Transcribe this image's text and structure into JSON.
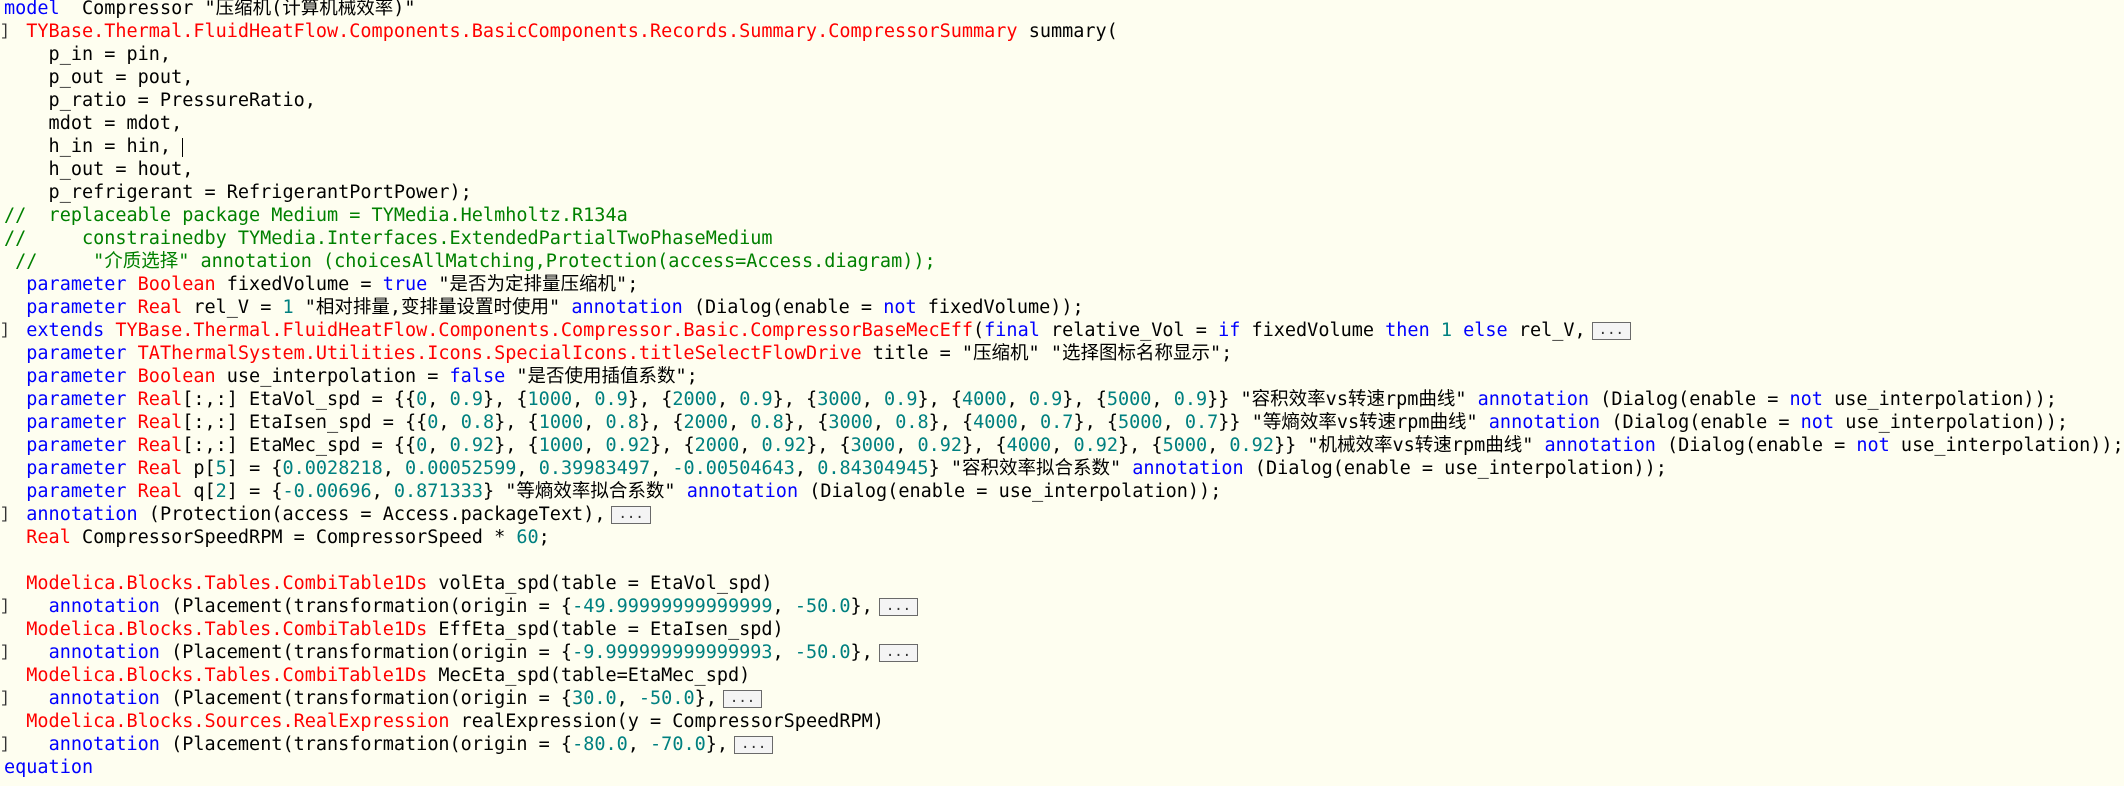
{
  "fold_label": "...",
  "lines": [
    {
      "fold": false,
      "tokens": [
        [
          "kw",
          "model"
        ],
        [
          "",
          "  Compressor "
        ],
        [
          "str",
          "\"压缩机(计算机械效率)\""
        ]
      ]
    },
    {
      "fold": true,
      "tokens": [
        [
          "",
          "  "
        ],
        [
          "ty",
          "TYBase.Thermal.FluidHeatFlow.Components.BasicComponents.Records.Summary.CompressorSummary"
        ],
        [
          "",
          " summary("
        ]
      ]
    },
    {
      "fold": false,
      "tokens": [
        [
          "",
          "    p_in = pin,"
        ]
      ]
    },
    {
      "fold": false,
      "tokens": [
        [
          "",
          "    p_out = pout,"
        ]
      ]
    },
    {
      "fold": false,
      "tokens": [
        [
          "",
          "    p_ratio = PressureRatio,"
        ]
      ]
    },
    {
      "fold": false,
      "tokens": [
        [
          "",
          "    mdot = mdot,"
        ]
      ]
    },
    {
      "fold": false,
      "cursor": true,
      "tokens": [
        [
          "",
          "    h_in = hin, "
        ]
      ]
    },
    {
      "fold": false,
      "tokens": [
        [
          "",
          "    h_out = hout,"
        ]
      ]
    },
    {
      "fold": false,
      "tokens": [
        [
          "",
          "    p_refrigerant = RefrigerantPortPower);"
        ]
      ]
    },
    {
      "fold": false,
      "tokens": [
        [
          "cm",
          "//  replaceable package Medium = TYMedia.Helmholtz.R134a"
        ]
      ]
    },
    {
      "fold": false,
      "tokens": [
        [
          "cm",
          "//     constrainedby TYMedia.Interfaces.ExtendedPartialTwoPhaseMedium"
        ]
      ]
    },
    {
      "fold": false,
      "tokens": [
        [
          "cm",
          " //     \"介质选择\" annotation (choicesAllMatching,Protection(access=Access.diagram));"
        ]
      ]
    },
    {
      "fold": false,
      "tokens": [
        [
          "",
          "  "
        ],
        [
          "kw",
          "parameter"
        ],
        [
          "",
          " "
        ],
        [
          "ty",
          "Boolean"
        ],
        [
          "",
          " fixedVolume = "
        ],
        [
          "kw",
          "true"
        ],
        [
          "",
          " "
        ],
        [
          "str",
          "\"是否为定排量压缩机\""
        ],
        [
          "",
          ";"
        ]
      ]
    },
    {
      "fold": false,
      "tokens": [
        [
          "",
          "  "
        ],
        [
          "kw",
          "parameter"
        ],
        [
          "",
          " "
        ],
        [
          "ty",
          "Real"
        ],
        [
          "",
          " rel_V = "
        ],
        [
          "num",
          "1"
        ],
        [
          "",
          " "
        ],
        [
          "str",
          "\"相对排量,变排量设置时使用\""
        ],
        [
          "",
          " "
        ],
        [
          "kw",
          "annotation"
        ],
        [
          "",
          " (Dialog(enable = "
        ],
        [
          "kw",
          "not"
        ],
        [
          "",
          " fixedVolume));"
        ]
      ]
    },
    {
      "fold": true,
      "more": true,
      "tokens": [
        [
          "",
          "  "
        ],
        [
          "kw",
          "extends"
        ],
        [
          "",
          " "
        ],
        [
          "ty",
          "TYBase.Thermal.FluidHeatFlow.Components.Compressor.Basic.CompressorBaseMecEff"
        ],
        [
          "",
          "("
        ],
        [
          "kw",
          "final"
        ],
        [
          "",
          " relative_Vol = "
        ],
        [
          "kw",
          "if"
        ],
        [
          "",
          " fixedVolume "
        ],
        [
          "kw",
          "then"
        ],
        [
          "",
          " "
        ],
        [
          "num",
          "1"
        ],
        [
          "",
          " "
        ],
        [
          "kw",
          "else"
        ],
        [
          "",
          " rel_V,"
        ]
      ]
    },
    {
      "fold": false,
      "tokens": [
        [
          "",
          "  "
        ],
        [
          "kw",
          "parameter"
        ],
        [
          "",
          " "
        ],
        [
          "ty",
          "TAThermalSystem.Utilities.Icons.SpecialIcons.titleSelectFlowDrive"
        ],
        [
          "",
          " title = "
        ],
        [
          "str",
          "\"压缩机\""
        ],
        [
          "",
          " "
        ],
        [
          "str",
          "\"选择图标名称显示\""
        ],
        [
          "",
          ";"
        ]
      ]
    },
    {
      "fold": false,
      "tokens": [
        [
          "",
          "  "
        ],
        [
          "kw",
          "parameter"
        ],
        [
          "",
          " "
        ],
        [
          "ty",
          "Boolean"
        ],
        [
          "",
          " use_interpolation = "
        ],
        [
          "kw",
          "false"
        ],
        [
          "",
          " "
        ],
        [
          "str",
          "\"是否使用插值系数\""
        ],
        [
          "",
          ";"
        ]
      ]
    },
    {
      "fold": false,
      "tokens": [
        [
          "",
          "  "
        ],
        [
          "kw",
          "parameter"
        ],
        [
          "",
          " "
        ],
        [
          "ty",
          "Real"
        ],
        [
          "",
          "[:,:] EtaVol_spd = {{"
        ],
        [
          "num",
          "0"
        ],
        [
          "",
          ", "
        ],
        [
          "num",
          "0.9"
        ],
        [
          "",
          "}, {"
        ],
        [
          "num",
          "1000"
        ],
        [
          "",
          ", "
        ],
        [
          "num",
          "0.9"
        ],
        [
          "",
          "}, {"
        ],
        [
          "num",
          "2000"
        ],
        [
          "",
          ", "
        ],
        [
          "num",
          "0.9"
        ],
        [
          "",
          "}, {"
        ],
        [
          "num",
          "3000"
        ],
        [
          "",
          ", "
        ],
        [
          "num",
          "0.9"
        ],
        [
          "",
          "}, {"
        ],
        [
          "num",
          "4000"
        ],
        [
          "",
          ", "
        ],
        [
          "num",
          "0.9"
        ],
        [
          "",
          "}, {"
        ],
        [
          "num",
          "5000"
        ],
        [
          "",
          ", "
        ],
        [
          "num",
          "0.9"
        ],
        [
          "",
          "}} "
        ],
        [
          "str",
          "\"容积效率vs转速rpm曲线\""
        ],
        [
          "",
          " "
        ],
        [
          "kw",
          "annotation"
        ],
        [
          "",
          " (Dialog(enable = "
        ],
        [
          "kw",
          "not"
        ],
        [
          "",
          " use_interpolation));"
        ]
      ]
    },
    {
      "fold": false,
      "tokens": [
        [
          "",
          "  "
        ],
        [
          "kw",
          "parameter"
        ],
        [
          "",
          " "
        ],
        [
          "ty",
          "Real"
        ],
        [
          "",
          "[:,:] EtaIsen_spd = {{"
        ],
        [
          "num",
          "0"
        ],
        [
          "",
          ", "
        ],
        [
          "num",
          "0.8"
        ],
        [
          "",
          "}, {"
        ],
        [
          "num",
          "1000"
        ],
        [
          "",
          ", "
        ],
        [
          "num",
          "0.8"
        ],
        [
          "",
          "}, {"
        ],
        [
          "num",
          "2000"
        ],
        [
          "",
          ", "
        ],
        [
          "num",
          "0.8"
        ],
        [
          "",
          "}, {"
        ],
        [
          "num",
          "3000"
        ],
        [
          "",
          ", "
        ],
        [
          "num",
          "0.8"
        ],
        [
          "",
          "}, {"
        ],
        [
          "num",
          "4000"
        ],
        [
          "",
          ", "
        ],
        [
          "num",
          "0.7"
        ],
        [
          "",
          "}, {"
        ],
        [
          "num",
          "5000"
        ],
        [
          "",
          ", "
        ],
        [
          "num",
          "0.7"
        ],
        [
          "",
          "}} "
        ],
        [
          "str",
          "\"等熵效率vs转速rpm曲线\""
        ],
        [
          "",
          " "
        ],
        [
          "kw",
          "annotation"
        ],
        [
          "",
          " (Dialog(enable = "
        ],
        [
          "kw",
          "not"
        ],
        [
          "",
          " use_interpolation));"
        ]
      ]
    },
    {
      "fold": false,
      "tokens": [
        [
          "",
          "  "
        ],
        [
          "kw",
          "parameter"
        ],
        [
          "",
          " "
        ],
        [
          "ty",
          "Real"
        ],
        [
          "",
          "[:,:] EtaMec_spd = {{"
        ],
        [
          "num",
          "0"
        ],
        [
          "",
          ", "
        ],
        [
          "num",
          "0.92"
        ],
        [
          "",
          "}, {"
        ],
        [
          "num",
          "1000"
        ],
        [
          "",
          ", "
        ],
        [
          "num",
          "0.92"
        ],
        [
          "",
          "}, {"
        ],
        [
          "num",
          "2000"
        ],
        [
          "",
          ", "
        ],
        [
          "num",
          "0.92"
        ],
        [
          "",
          "}, {"
        ],
        [
          "num",
          "3000"
        ],
        [
          "",
          ", "
        ],
        [
          "num",
          "0.92"
        ],
        [
          "",
          "}, {"
        ],
        [
          "num",
          "4000"
        ],
        [
          "",
          ", "
        ],
        [
          "num",
          "0.92"
        ],
        [
          "",
          "}, {"
        ],
        [
          "num",
          "5000"
        ],
        [
          "",
          ", "
        ],
        [
          "num",
          "0.92"
        ],
        [
          "",
          "}} "
        ],
        [
          "str",
          "\"机械效率vs转速rpm曲线\""
        ],
        [
          "",
          " "
        ],
        [
          "kw",
          "annotation"
        ],
        [
          "",
          " (Dialog(enable = "
        ],
        [
          "kw",
          "not"
        ],
        [
          "",
          " use_interpolation));"
        ]
      ]
    },
    {
      "fold": false,
      "tokens": [
        [
          "",
          "  "
        ],
        [
          "kw",
          "parameter"
        ],
        [
          "",
          " "
        ],
        [
          "ty",
          "Real"
        ],
        [
          "",
          " p["
        ],
        [
          "num",
          "5"
        ],
        [
          "",
          "] = {"
        ],
        [
          "num",
          "0.0028218"
        ],
        [
          "",
          ", "
        ],
        [
          "num",
          "0.00052599"
        ],
        [
          "",
          ", "
        ],
        [
          "num",
          "0.39983497"
        ],
        [
          "",
          ", "
        ],
        [
          "num",
          "-0.00504643"
        ],
        [
          "",
          ", "
        ],
        [
          "num",
          "0.84304945"
        ],
        [
          "",
          "} "
        ],
        [
          "str",
          "\"容积效率拟合系数\""
        ],
        [
          "",
          " "
        ],
        [
          "kw",
          "annotation"
        ],
        [
          "",
          " (Dialog(enable = use_interpolation));"
        ]
      ]
    },
    {
      "fold": false,
      "tokens": [
        [
          "",
          "  "
        ],
        [
          "kw",
          "parameter"
        ],
        [
          "",
          " "
        ],
        [
          "ty",
          "Real"
        ],
        [
          "",
          " q["
        ],
        [
          "num",
          "2"
        ],
        [
          "",
          "] = {"
        ],
        [
          "num",
          "-0.00696"
        ],
        [
          "",
          ", "
        ],
        [
          "num",
          "0.871333"
        ],
        [
          "",
          "} "
        ],
        [
          "str",
          "\"等熵效率拟合系数\""
        ],
        [
          "",
          " "
        ],
        [
          "kw",
          "annotation"
        ],
        [
          "",
          " (Dialog(enable = use_interpolation));"
        ]
      ]
    },
    {
      "fold": true,
      "more": true,
      "tokens": [
        [
          "",
          "  "
        ],
        [
          "kw",
          "annotation"
        ],
        [
          "",
          " (Protection(access = Access.packageText),"
        ]
      ]
    },
    {
      "fold": false,
      "tokens": [
        [
          "",
          "  "
        ],
        [
          "ty",
          "Real"
        ],
        [
          "",
          " CompressorSpeedRPM = CompressorSpeed * "
        ],
        [
          "num",
          "60"
        ],
        [
          "",
          ";"
        ]
      ]
    },
    {
      "fold": false,
      "tokens": [
        [
          "",
          ""
        ]
      ]
    },
    {
      "fold": false,
      "tokens": [
        [
          "",
          "  "
        ],
        [
          "ty",
          "Modelica.Blocks.Tables.CombiTable1Ds"
        ],
        [
          "",
          " volEta_spd(table = EtaVol_spd)"
        ]
      ]
    },
    {
      "fold": true,
      "more": true,
      "tokens": [
        [
          "",
          "    "
        ],
        [
          "kw",
          "annotation"
        ],
        [
          "",
          " (Placement(transformation(origin = {"
        ],
        [
          "num",
          "-49.99999999999999"
        ],
        [
          "",
          ", "
        ],
        [
          "num",
          "-50.0"
        ],
        [
          "",
          "},"
        ]
      ]
    },
    {
      "fold": false,
      "tokens": [
        [
          "",
          "  "
        ],
        [
          "ty",
          "Modelica.Blocks.Tables.CombiTable1Ds"
        ],
        [
          "",
          " EffEta_spd(table = EtaIsen_spd)"
        ]
      ]
    },
    {
      "fold": true,
      "more": true,
      "tokens": [
        [
          "",
          "    "
        ],
        [
          "kw",
          "annotation"
        ],
        [
          "",
          " (Placement(transformation(origin = {"
        ],
        [
          "num",
          "-9.999999999999993"
        ],
        [
          "",
          ", "
        ],
        [
          "num",
          "-50.0"
        ],
        [
          "",
          "},"
        ]
      ]
    },
    {
      "fold": false,
      "tokens": [
        [
          "",
          "  "
        ],
        [
          "ty",
          "Modelica.Blocks.Tables.CombiTable1Ds"
        ],
        [
          "",
          " MecEta_spd(table=EtaMec_spd)"
        ]
      ]
    },
    {
      "fold": true,
      "more": true,
      "tokens": [
        [
          "",
          "    "
        ],
        [
          "kw",
          "annotation"
        ],
        [
          "",
          " (Placement(transformation(origin = {"
        ],
        [
          "num",
          "30.0"
        ],
        [
          "",
          ", "
        ],
        [
          "num",
          "-50.0"
        ],
        [
          "",
          "},"
        ]
      ]
    },
    {
      "fold": false,
      "tokens": [
        [
          "",
          "  "
        ],
        [
          "ty",
          "Modelica.Blocks.Sources.RealExpression"
        ],
        [
          "",
          " realExpression(y = CompressorSpeedRPM)"
        ]
      ]
    },
    {
      "fold": true,
      "more": true,
      "tokens": [
        [
          "",
          "    "
        ],
        [
          "kw",
          "annotation"
        ],
        [
          "",
          " (Placement(transformation(origin = {"
        ],
        [
          "num",
          "-80.0"
        ],
        [
          "",
          ", "
        ],
        [
          "num",
          "-70.0"
        ],
        [
          "",
          "},"
        ]
      ]
    },
    {
      "fold": false,
      "tokens": [
        [
          "kw",
          "equation"
        ]
      ]
    }
  ]
}
